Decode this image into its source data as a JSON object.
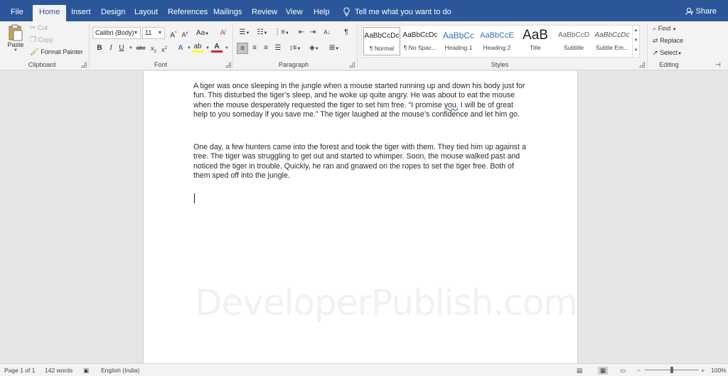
{
  "tabs": [
    "File",
    "Home",
    "Insert",
    "Design",
    "Layout",
    "References",
    "Mailings",
    "Review",
    "View",
    "Help"
  ],
  "active_tab": "Home",
  "tell_me": "Tell me what you want to do",
  "share": "Share",
  "clipboard": {
    "paste": "Paste",
    "cut": "Cut",
    "copy": "Copy",
    "format_painter": "Format Painter",
    "label": "Clipboard"
  },
  "font": {
    "name": "Calibri (Body)",
    "size": "11",
    "label": "Font",
    "change_case": "Aa"
  },
  "paragraph": {
    "label": "Paragraph"
  },
  "styles": {
    "label": "Styles",
    "items": [
      {
        "preview": "AaBbCcDc",
        "name": "¶ Normal"
      },
      {
        "preview": "AaBbCcDc",
        "name": "¶ No Spac..."
      },
      {
        "preview": "AaBbCc",
        "name": "Heading 1"
      },
      {
        "preview": "AaBbCcE",
        "name": "Heading 2"
      },
      {
        "preview": "AaB",
        "name": "Title"
      },
      {
        "preview": "AaBbCcD",
        "name": "Subtitle"
      },
      {
        "preview": "AaBbCcDc",
        "name": "Subtle Em..."
      }
    ]
  },
  "editing": {
    "find": "Find",
    "replace": "Replace",
    "select": "Select",
    "label": "Editing"
  },
  "document": {
    "para1_before": "A tiger was once sleeping in the jungle when a mouse started running up and down his body just for fun. This disturbed the tiger’s sleep, and he woke up quite angry. He was about to eat the mouse when the mouse desperately requested the tiger to set him free. “I promise ",
    "para1_flag": "you.",
    "para1_after": " I will be of great help to you someday if you save me.” The tiger laughed at the mouse’s confidence and let him go.",
    "para2": "One day, a few hunters came into the forest and took the tiger with them. They tied him up against a tree. The tiger was struggling to get out and started to whimper. Soon, the mouse walked past and noticed the tiger in trouble. Quickly, he ran and gnawed on the ropes to set the tiger free. Both of them sped off into the jungle.",
    "watermark": "DeveloperPublish.com"
  },
  "status": {
    "page": "Page 1 of 1",
    "words": "142 words",
    "language": "English (India)",
    "zoom": "100%",
    "zoom_level": 1.0,
    "zoom_minus": "−",
    "zoom_plus": "+"
  },
  "colors": {
    "brand": "#2b579a",
    "ribbon": "#f3f3f3",
    "canvas": "#e6e6e6"
  }
}
